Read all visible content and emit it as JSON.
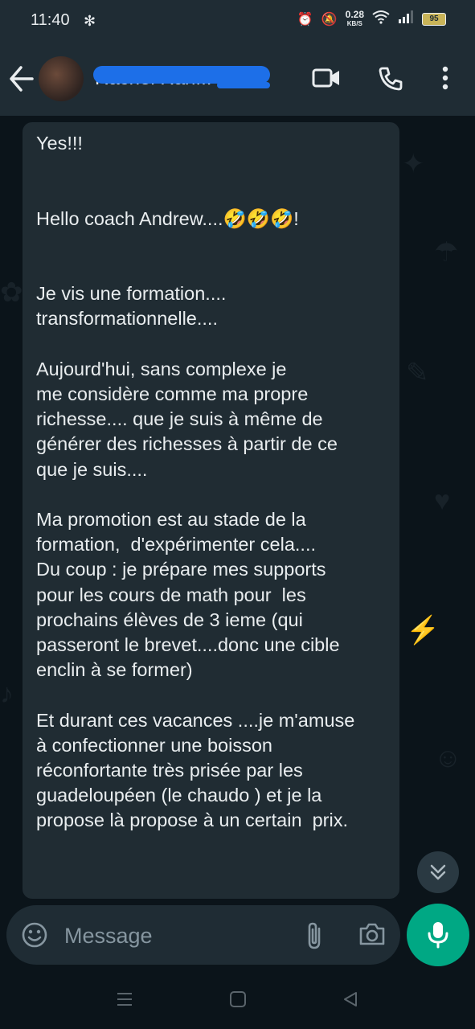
{
  "status_bar": {
    "time": "11:40",
    "net_speed": "0.28",
    "net_unit": "KB/S",
    "battery": "95"
  },
  "header": {
    "contact_name": "Rachel Ran..."
  },
  "message": {
    "text": "Yes!!!\n\n\nHello coach Andrew....🤣🤣🤣!\n\n\nJe vis une formation....\ntransformationnelle....\n\nAujourd'hui, sans complexe je\nme considère comme ma propre\nrichesse.... que je suis à même de\ngénérer des richesses à partir de ce\nque je suis....\n\nMa promotion est au stade de la\nformation,  d'expérimenter cela....\nDu coup : je prépare mes supports\npour les cours de math pour  les\nprochains élèves de 3 ieme (qui\npasseront le brevet....donc une cible\nenclin à se former)\n\nEt durant ces vacances ....je m'amuse\nà confectionner une boisson\nréconfortante très prisée par les\nguadeloupéen (le chaudo ) et je la\npropose là propose à un certain  prix."
  },
  "composer": {
    "placeholder": "Message"
  },
  "colors": {
    "accent": "#00a884",
    "bubble": "#202c33",
    "header": "#1f2c34"
  },
  "icons": [
    "back-arrow-icon",
    "video-call-icon",
    "voice-call-icon",
    "more-options-icon",
    "emoji-icon",
    "attach-icon",
    "camera-icon",
    "mic-icon",
    "scroll-down-icon"
  ]
}
